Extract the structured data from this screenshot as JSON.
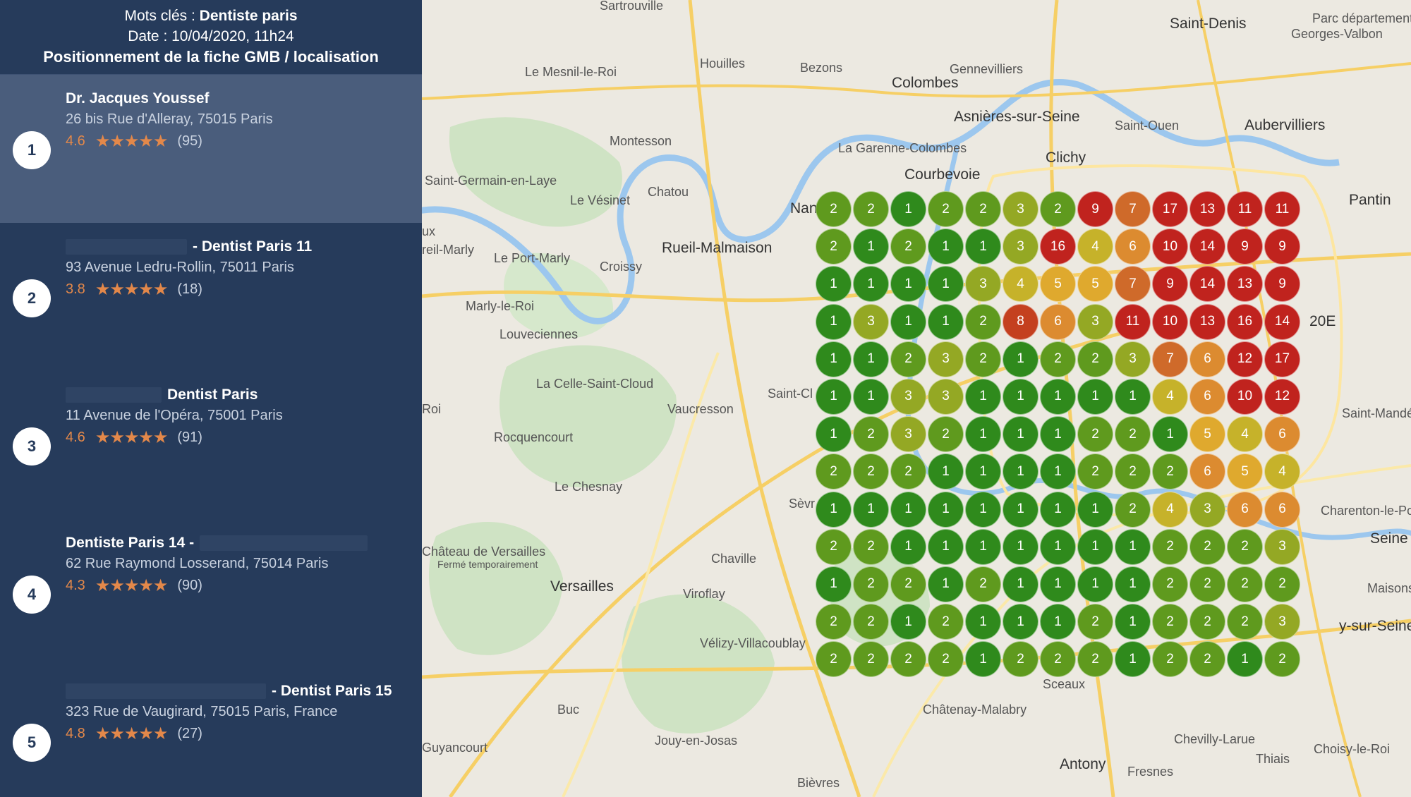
{
  "header": {
    "keywords_label": "Mots clés : ",
    "keywords_value": "Dentiste paris",
    "date_line": "Date : 10/04/2020, 11h24",
    "title": "Positionnement de la fiche GMB / localisation"
  },
  "results": [
    {
      "rank": "1",
      "name": "Dr. Jacques Youssef",
      "address": "26 bis Rue d'Alleray, 75015 Paris",
      "rating": "4.6",
      "stars": "★★★★★",
      "reviews": "(95)"
    },
    {
      "rank": "2",
      "name": "- Dentist Paris 11",
      "address": "93 Avenue Ledru-Rollin, 75011 Paris",
      "rating": "3.8",
      "stars": "★★★★★",
      "reviews": "(18)"
    },
    {
      "rank": "3",
      "name": "Dentist Paris",
      "address": "11 Avenue de l'Opéra, 75001 Paris",
      "rating": "4.6",
      "stars": "★★★★★",
      "reviews": "(91)"
    },
    {
      "rank": "4",
      "name": "Dentiste Paris 14 -",
      "address": "62 Rue Raymond Losserand, 75014 Paris",
      "rating": "4.3",
      "stars": "★★★★★",
      "reviews": "(90)"
    },
    {
      "rank": "5",
      "name": "- Dentist Paris 15",
      "address": "323 Rue de Vaugirard, 75015 Paris, France",
      "rating": "4.8",
      "stars": "★★★★★",
      "reviews": "(27)"
    }
  ],
  "map_labels": [
    "Sartrouville",
    "Saint-Denis",
    "Parc départemental",
    "Georges-Valbon",
    "Houilles",
    "Bezons",
    "Colombes",
    "Gennevilliers",
    "Le Mesnil-le-Roi",
    "Asnières-sur-Seine",
    "Saint-Ouen",
    "Aubervilliers",
    "Montesson",
    "La Garenne-Colombes",
    "Clichy",
    "Courbevoie",
    "Saint-Germain-en-Laye",
    "Chatou",
    "Le Vésinet",
    "Pantin",
    "Nan",
    "Rueil-Malmaison",
    "Le Port-Marly",
    "Croissy",
    "Marly-le-Roi",
    "Louveciennes",
    "20E",
    "La Celle-Saint-Cloud",
    "Vaucresson",
    "Saint-Cl",
    "Saint-Mandé",
    "Rocquencourt",
    "Le Chesnay",
    "Sèvr",
    "Château de Versailles",
    "Fermé temporairement",
    "Versailles",
    "Chaville",
    "Viroflay",
    "Vélizy-Villacoublay",
    "Charenton-le-Po",
    "Seine",
    "Sceaux",
    "Châtenay-Malabry",
    "Buc",
    "Jouy-en-Josas",
    "Chevilly-Larue",
    "Choisy-le-Roi",
    "Antony",
    "Fresnes",
    "Thiais",
    "Bièvres",
    "Guyancourt",
    "Maisons",
    "y-sur-Seine",
    "Roi",
    "ux",
    "reil-Marly"
  ],
  "grid": [
    [
      2,
      2,
      1,
      2,
      2,
      3,
      2,
      9,
      7,
      17,
      13,
      11,
      11
    ],
    [
      2,
      1,
      2,
      1,
      1,
      3,
      16,
      4,
      6,
      10,
      14,
      9,
      9
    ],
    [
      1,
      1,
      1,
      1,
      3,
      4,
      5,
      5,
      7,
      9,
      14,
      13,
      9
    ],
    [
      1,
      3,
      1,
      1,
      2,
      8,
      6,
      3,
      11,
      10,
      13,
      16,
      14
    ],
    [
      1,
      1,
      2,
      3,
      2,
      1,
      2,
      2,
      3,
      7,
      6,
      12,
      17
    ],
    [
      1,
      1,
      3,
      3,
      1,
      1,
      1,
      1,
      1,
      4,
      6,
      10,
      12
    ],
    [
      1,
      2,
      3,
      2,
      1,
      1,
      1,
      2,
      2,
      1,
      5,
      4,
      6
    ],
    [
      2,
      2,
      2,
      1,
      1,
      1,
      1,
      2,
      2,
      2,
      6,
      5,
      4
    ],
    [
      1,
      1,
      1,
      1,
      1,
      1,
      1,
      1,
      2,
      4,
      3,
      6,
      6
    ],
    [
      2,
      2,
      1,
      1,
      1,
      1,
      1,
      1,
      1,
      2,
      2,
      2,
      3
    ],
    [
      1,
      2,
      2,
      1,
      2,
      1,
      1,
      1,
      1,
      2,
      2,
      2,
      2
    ],
    [
      2,
      2,
      1,
      2,
      1,
      1,
      1,
      2,
      1,
      2,
      2,
      2,
      3
    ],
    [
      2,
      2,
      2,
      2,
      1,
      2,
      2,
      2,
      1,
      2,
      2,
      1,
      2
    ]
  ],
  "colors": {
    "sidebar": "#263b5b",
    "sidebar_active": "#4a5d7c",
    "accent_orange": "#e3884a",
    "rank_1": "#2f8a1c",
    "rank_2": "#5f9a1e",
    "rank_3": "#94a824",
    "rank_4": "#c6b22a",
    "rank_5": "#dfa92e",
    "rank_6": "#dc8b30",
    "rank_7": "#cf6a2a",
    "rank_8": "#c4401f",
    "rank_9plus": "#c0231e"
  }
}
